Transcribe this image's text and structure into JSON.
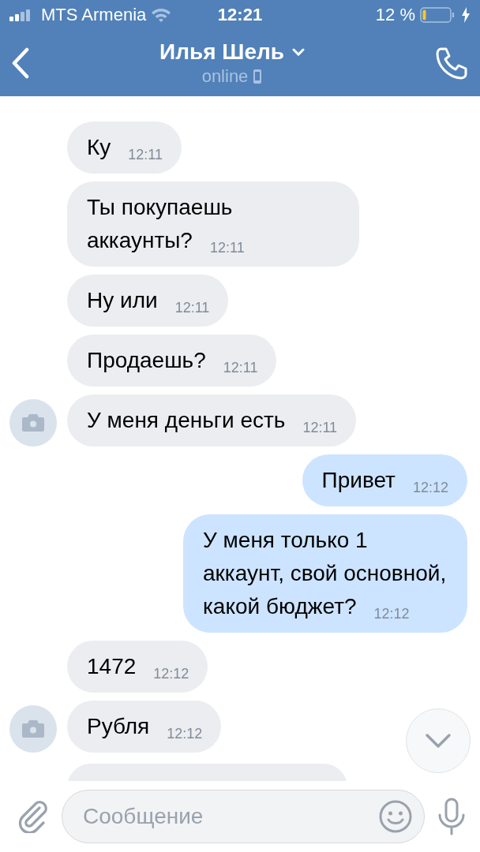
{
  "status_bar": {
    "carrier": "MTS Armenia",
    "time": "12:21",
    "battery_text": "12 %"
  },
  "header": {
    "title": "Илья Шель",
    "subtitle": "online"
  },
  "messages": [
    {
      "kind": "text",
      "outgoing": false,
      "avatar": false,
      "text": "Ку",
      "time": "12:11"
    },
    {
      "kind": "text",
      "outgoing": false,
      "avatar": false,
      "text": "Ты покупаешь аккаунты?",
      "time": "12:11"
    },
    {
      "kind": "text",
      "outgoing": false,
      "avatar": false,
      "text": "Ну или",
      "time": "12:11"
    },
    {
      "kind": "text",
      "outgoing": false,
      "avatar": false,
      "text": "Продаешь?",
      "time": "12:11"
    },
    {
      "kind": "text",
      "outgoing": false,
      "avatar": true,
      "text": "У меня деньги есть",
      "time": "12:11"
    },
    {
      "kind": "text",
      "outgoing": true,
      "avatar": false,
      "text": "Привет",
      "time": "12:12"
    },
    {
      "kind": "text",
      "outgoing": true,
      "avatar": false,
      "text": "У меня только 1 аккаунт, свой основной, какой бюджет?",
      "time": "12:12"
    },
    {
      "kind": "text",
      "outgoing": false,
      "avatar": false,
      "text": "1472",
      "time": "12:12"
    },
    {
      "kind": "text",
      "outgoing": false,
      "avatar": true,
      "text": "Рубля",
      "time": "12:12"
    },
    {
      "kind": "partial",
      "outgoing": false,
      "avatar": false
    }
  ],
  "composer": {
    "placeholder": "Сообщение"
  }
}
